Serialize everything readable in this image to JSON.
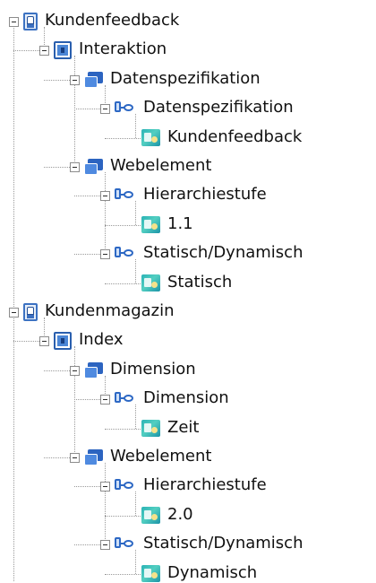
{
  "tree": [
    {
      "label": "Kundenfeedback",
      "icon": "application-icon",
      "children": [
        {
          "label": "Interaktion",
          "icon": "object-icon",
          "children": [
            {
              "label": "Datenspezifikation",
              "icon": "class-icon",
              "children": [
                {
                  "label": "Datenspezifikation",
                  "icon": "attribute-icon",
                  "children": [
                    {
                      "label": "Kundenfeedback",
                      "icon": "value-icon"
                    }
                  ]
                }
              ]
            },
            {
              "label": "Webelement",
              "icon": "class-icon",
              "children": [
                {
                  "label": "Hierarchiestufe",
                  "icon": "attribute-icon",
                  "children": [
                    {
                      "label": "1.1",
                      "icon": "value-icon"
                    }
                  ]
                },
                {
                  "label": "Statisch/Dynamisch",
                  "icon": "attribute-icon",
                  "children": [
                    {
                      "label": "Statisch",
                      "icon": "value-icon"
                    }
                  ]
                }
              ]
            }
          ]
        }
      ]
    },
    {
      "label": "Kundenmagazin",
      "icon": "application-icon",
      "children": [
        {
          "label": "Index",
          "icon": "object-icon",
          "children": [
            {
              "label": "Dimension",
              "icon": "class-icon",
              "children": [
                {
                  "label": "Dimension",
                  "icon": "attribute-icon",
                  "children": [
                    {
                      "label": "Zeit",
                      "icon": "value-icon"
                    }
                  ]
                }
              ]
            },
            {
              "label": "Webelement",
              "icon": "class-icon",
              "children": [
                {
                  "label": "Hierarchiestufe",
                  "icon": "attribute-icon",
                  "children": [
                    {
                      "label": "2.0",
                      "icon": "value-icon"
                    }
                  ]
                },
                {
                  "label": "Statisch/Dynamisch",
                  "icon": "attribute-icon",
                  "children": [
                    {
                      "label": "Dynamisch",
                      "icon": "value-icon"
                    }
                  ]
                }
              ]
            }
          ]
        }
      ]
    }
  ]
}
